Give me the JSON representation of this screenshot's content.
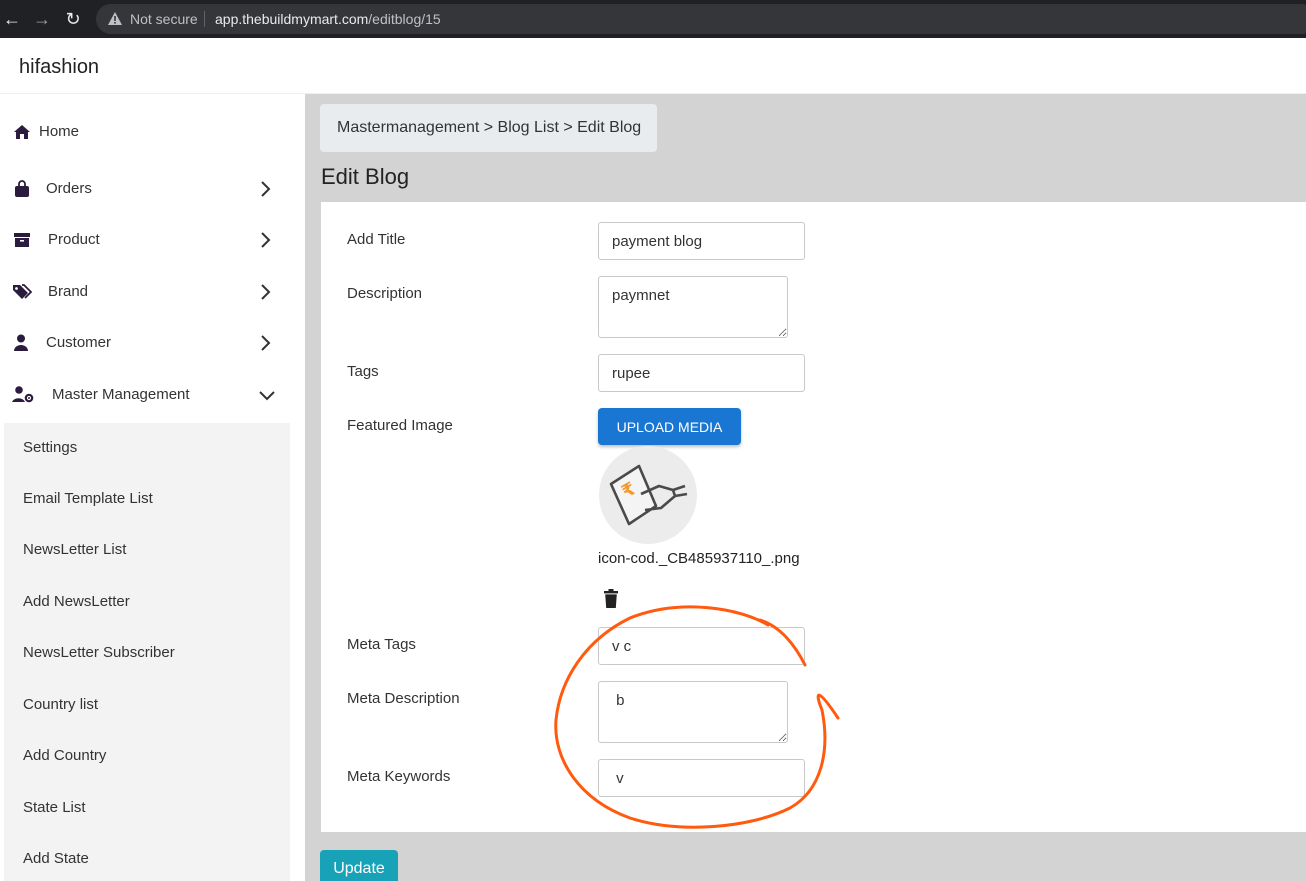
{
  "browser": {
    "not_secure": "Not secure",
    "url_host": "app.thebuildmymart.com",
    "url_path": "/editblog/15"
  },
  "app": {
    "brand": "hifashion"
  },
  "sidebar": {
    "items": [
      {
        "label": "Home",
        "icon": "home-icon"
      },
      {
        "label": "Orders",
        "icon": "bag-icon"
      },
      {
        "label": "Product",
        "icon": "archive-icon"
      },
      {
        "label": "Brand",
        "icon": "tags-icon"
      },
      {
        "label": "Customer",
        "icon": "user-icon"
      },
      {
        "label": "Master Management",
        "icon": "user-gear-icon"
      }
    ],
    "submenu": [
      "Settings",
      "Email Template List",
      "NewsLetter List",
      "Add NewsLetter",
      "NewsLetter Subscriber",
      "Country list",
      "Add Country",
      "State List",
      "Add State"
    ]
  },
  "main": {
    "breadcrumb": "Mastermanagement > Blog List > Edit Blog",
    "title": "Edit Blog",
    "form": {
      "title_label": "Add Title",
      "title_value": "payment blog",
      "description_label": "Description",
      "description_value": "paymnet",
      "tags_label": "Tags",
      "tags_value": "rupee",
      "featured_label": "Featured Image",
      "upload_label": "UPLOAD MEDIA",
      "file_name": "icon-cod._CB485937110_.png",
      "meta_tags_label": "Meta Tags",
      "meta_tags_value": "v c",
      "meta_description_label": "Meta Description",
      "meta_description_value": " b",
      "meta_keywords_label": "Meta Keywords",
      "meta_keywords_value": " v"
    },
    "update_label": "Update"
  },
  "colors": {
    "primary_button": "#1976d2",
    "update_button": "#17a2b8",
    "annotation": "#ff5a0d",
    "content_bg": "#d3d3d3"
  }
}
